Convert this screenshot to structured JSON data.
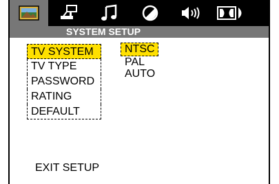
{
  "tabs": [
    {
      "icon": "picture-icon",
      "active": true
    },
    {
      "icon": "setup-icon",
      "active": false
    },
    {
      "icon": "music-note-icon",
      "active": false
    },
    {
      "icon": "contrast-icon",
      "active": false
    },
    {
      "icon": "speaker-icon",
      "active": false
    },
    {
      "icon": "dolby-icon",
      "active": false
    }
  ],
  "header": {
    "title": "SYSTEM SETUP"
  },
  "menu": {
    "items": [
      {
        "label": "TV SYSTEM",
        "selected": true
      },
      {
        "label": "TV TYPE",
        "selected": false
      },
      {
        "label": "PASSWORD",
        "selected": false
      },
      {
        "label": "RATING",
        "selected": false
      },
      {
        "label": "DEFAULT",
        "selected": false
      }
    ]
  },
  "options": {
    "items": [
      {
        "label": "NTSC",
        "selected": true
      },
      {
        "label": "PAL",
        "selected": false
      },
      {
        "label": "AUTO",
        "selected": false
      }
    ]
  },
  "footer": {
    "exit_label": "EXIT SETUP"
  },
  "colors": {
    "highlight": "#ffe000",
    "bar": "#000000",
    "subbar": "#777777"
  }
}
